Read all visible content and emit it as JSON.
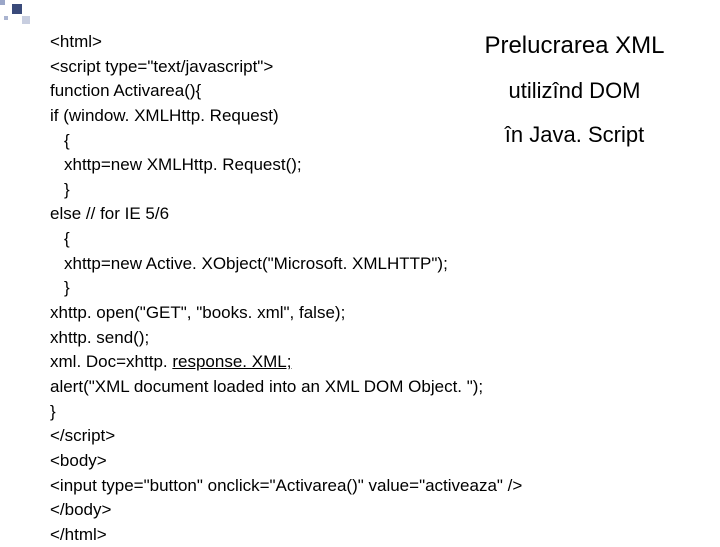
{
  "deco": {},
  "titles": {
    "t1": "Prelucrarea XML",
    "t2": "utilizînd DOM",
    "t3": "în Java. Script"
  },
  "code": {
    "l1": "<html>",
    "l2": "<script type=\"text/javascript\">",
    "l3": "function Activarea(){",
    "l4": "if (window. XMLHttp. Request)",
    "l5": "{",
    "l6": "xhttp=new XMLHttp. Request();",
    "l7": "}",
    "l8": "else // for IE 5/6",
    "l9": "{",
    "l10": "xhttp=new Active. XObject(\"Microsoft. XMLHTTP\");",
    "l11": "}",
    "l12": "xhttp. open(\"GET\", \"books. xml\", false);",
    "l13": "xhttp. send();",
    "l14a": "xml. Doc=xhttp. ",
    "l14b": "response. XML;",
    "l15": "alert(\"XML document loaded into an XML DOM Object. \");",
    "l16": "}",
    "l17": "</script>",
    "l18": "<body>",
    "l19": "<input type=\"button\" onclick=\"Activarea()\" value=\"activeaza\" />",
    "l20": "</body>",
    "l21": "</html>"
  }
}
